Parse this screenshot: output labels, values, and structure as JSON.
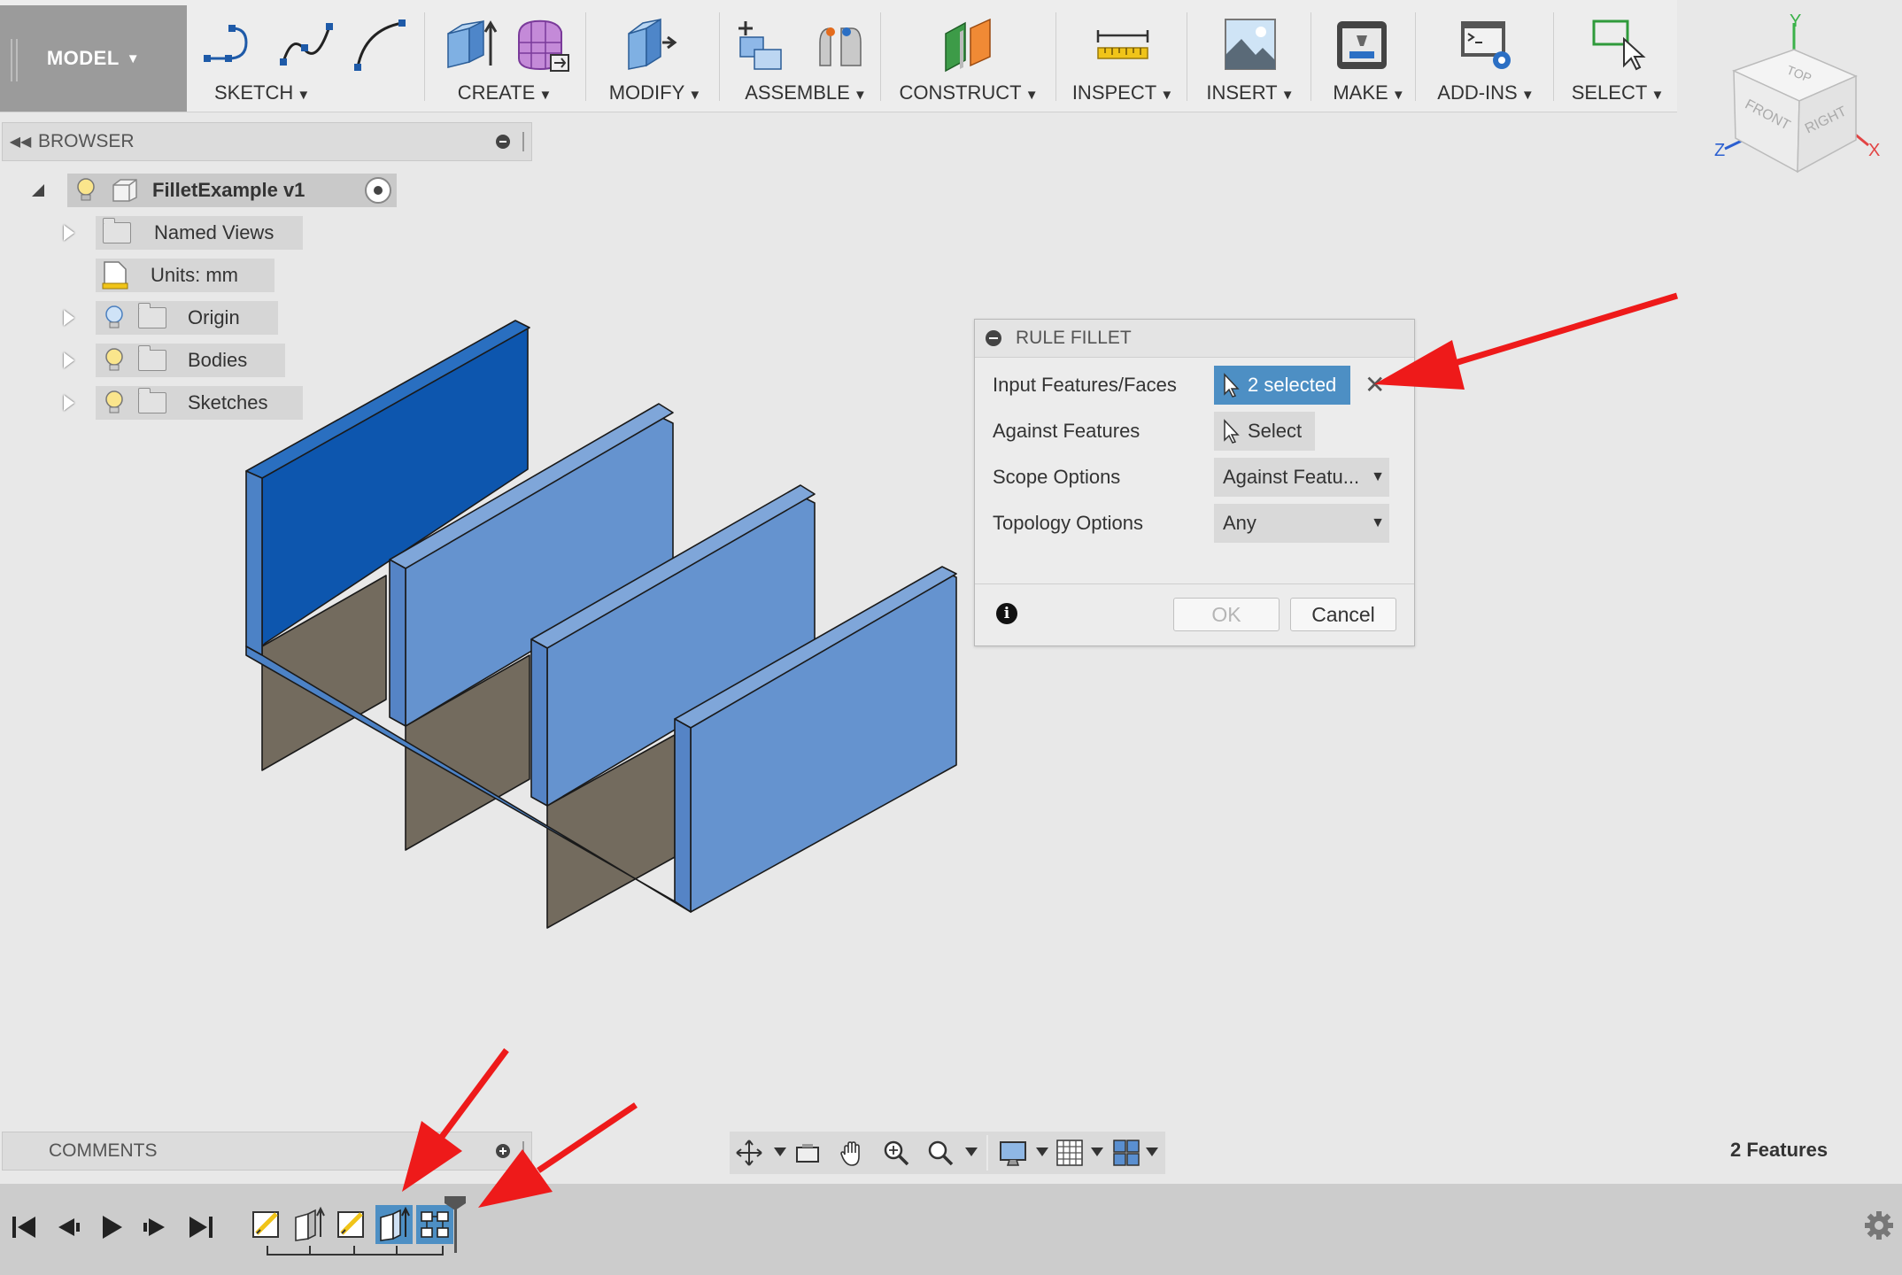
{
  "toolbar": {
    "workspace": "MODEL",
    "groups": [
      {
        "label": "SKETCH"
      },
      {
        "label": "CREATE"
      },
      {
        "label": "MODIFY"
      },
      {
        "label": "ASSEMBLE"
      },
      {
        "label": "CONSTRUCT"
      },
      {
        "label": "INSPECT"
      },
      {
        "label": "INSERT"
      },
      {
        "label": "MAKE"
      },
      {
        "label": "ADD-INS"
      },
      {
        "label": "SELECT"
      }
    ]
  },
  "browser": {
    "title": "BROWSER",
    "root": "FilletExample v1",
    "items": [
      {
        "label": "Named Views"
      },
      {
        "label": "Units: mm"
      },
      {
        "label": "Origin"
      },
      {
        "label": "Bodies"
      },
      {
        "label": "Sketches"
      }
    ]
  },
  "view_cube": {
    "top": "TOP",
    "front": "FRONT",
    "right": "RIGHT",
    "axis_x": "X",
    "axis_y": "Y",
    "axis_z": "Z"
  },
  "dialog": {
    "title": "RULE FILLET",
    "rows": [
      {
        "label": "Input Features/Faces",
        "value": "2 selected"
      },
      {
        "label": "Against Features",
        "value": "Select"
      },
      {
        "label": "Scope Options",
        "value": "Against Featu..."
      },
      {
        "label": "Topology Options",
        "value": "Any"
      }
    ],
    "ok": "OK",
    "cancel": "Cancel"
  },
  "comments": {
    "title": "COMMENTS"
  },
  "status": {
    "features": "2 Features"
  },
  "colors": {
    "selection": "#4d8fc4",
    "body_face": "#6593cf",
    "body_face_dark": "#0d56ae",
    "body_floor": "#736b5e",
    "annotation_arrow": "#ee1a1a"
  }
}
